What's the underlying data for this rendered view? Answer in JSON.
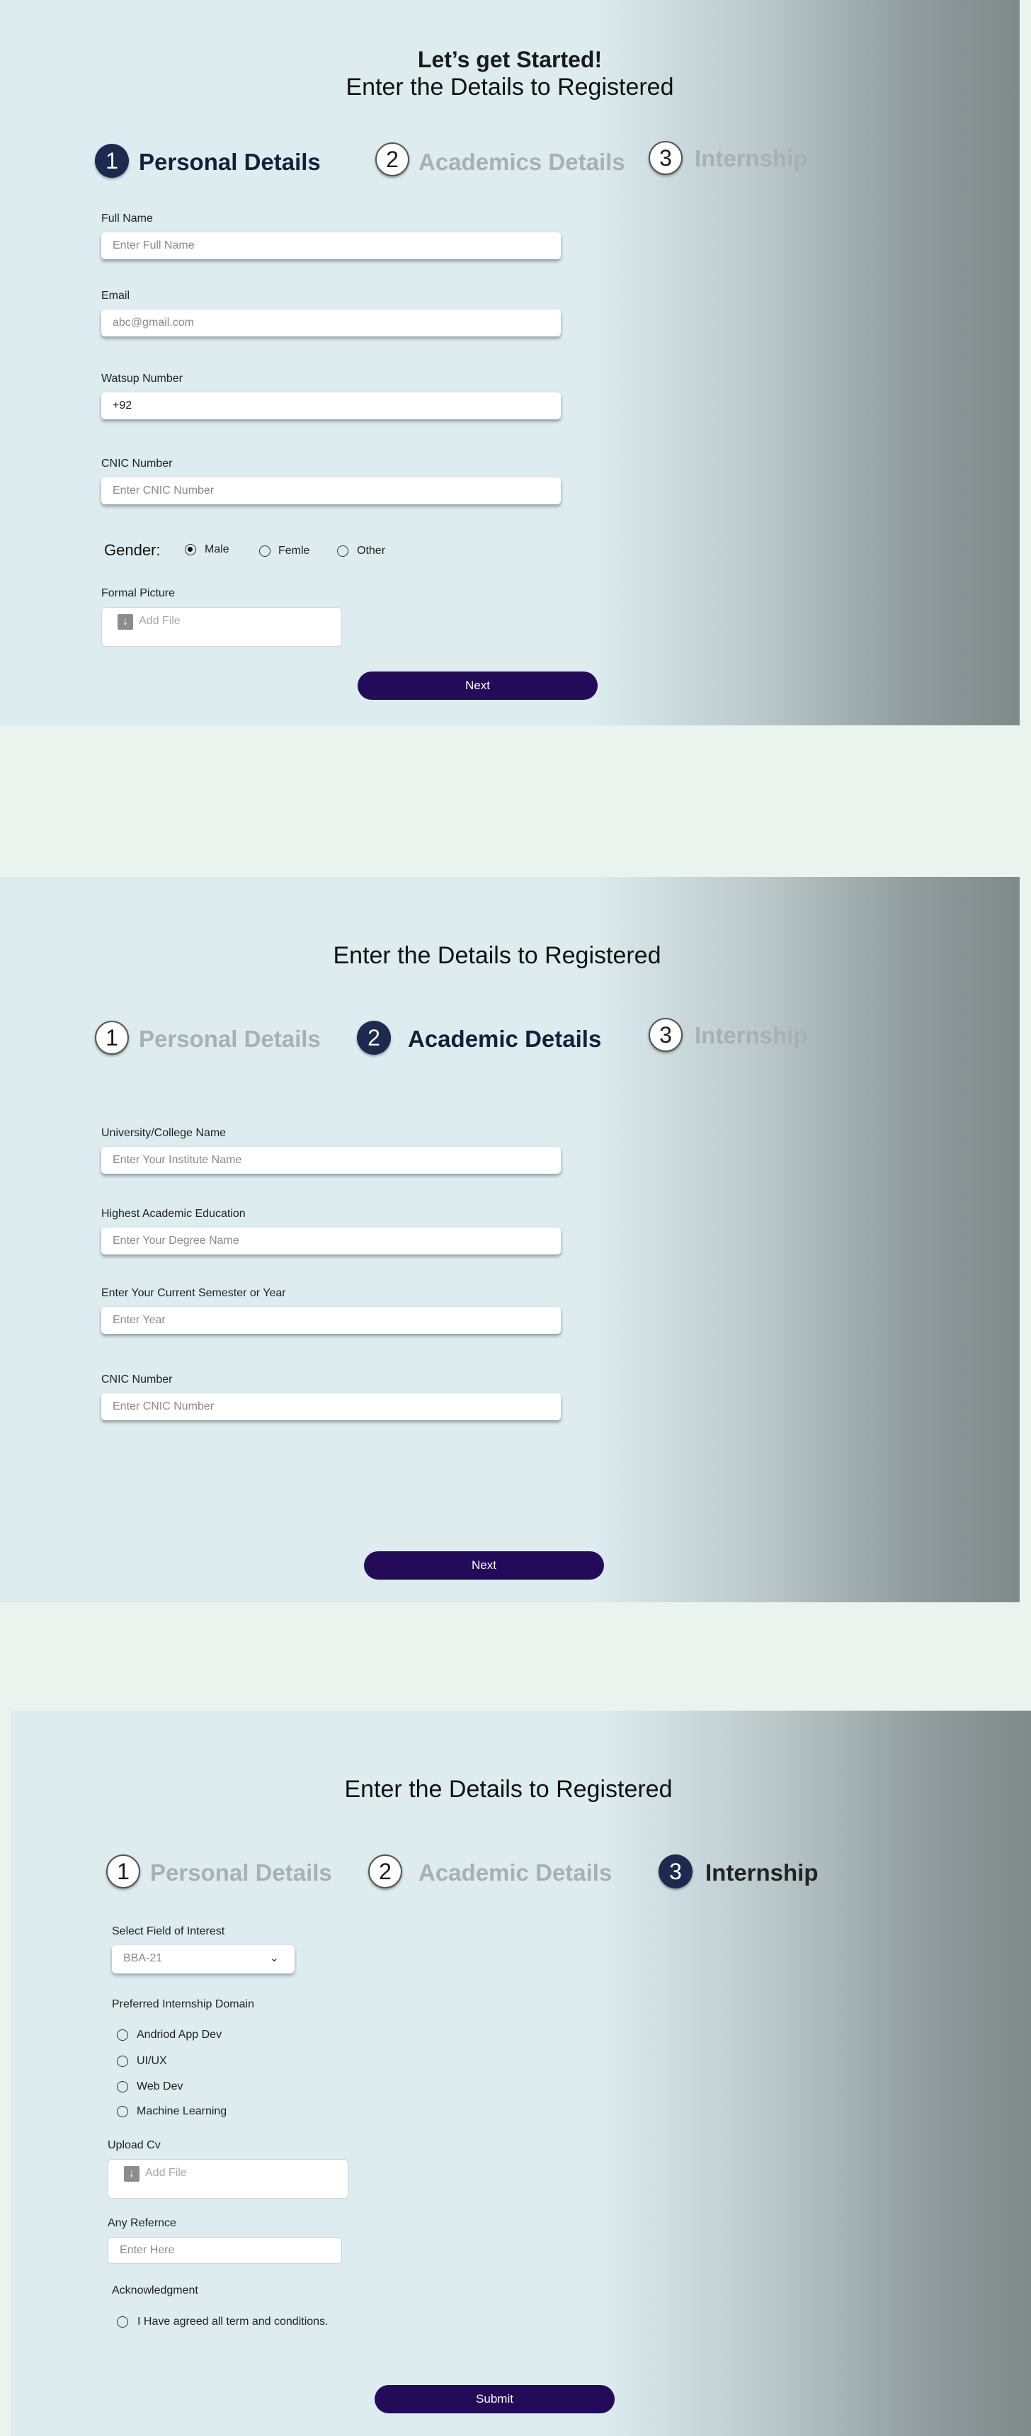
{
  "section1": {
    "heading": "Let’s get Started!",
    "subheading": "Enter the Details to Registered",
    "steps": [
      {
        "num": "1",
        "label": "Personal Details",
        "state": "active"
      },
      {
        "num": "2",
        "label": "Academics Details",
        "state": "inactive"
      },
      {
        "num": "3",
        "label": "Internship",
        "state": "inactive"
      }
    ],
    "fields": {
      "full_name": {
        "label": "Full Name",
        "placeholder": "Enter Full Name"
      },
      "email": {
        "label": "Email",
        "placeholder": "abc@gmail.com"
      },
      "whatsapp": {
        "label": "Watsup Number",
        "value": "+92"
      },
      "cnic": {
        "label": "CNIC Number",
        "placeholder": "Enter CNIC Number"
      }
    },
    "gender": {
      "label": "Gender:",
      "options": [
        "Male",
        "Femle",
        "Other"
      ],
      "selected": "Male"
    },
    "picture": {
      "label": "Formal Picture",
      "placeholder": "Add File"
    },
    "next_label": "Next"
  },
  "section2": {
    "subheading": "Enter the Details to Registered",
    "steps": [
      {
        "num": "1",
        "label": "Personal Details",
        "state": "inactive"
      },
      {
        "num": "2",
        "label": "Academic Details",
        "state": "active"
      },
      {
        "num": "3",
        "label": "Internship",
        "state": "inactive"
      }
    ],
    "fields": {
      "institute": {
        "label": "University/College Name",
        "placeholder": "Enter Your Institute Name"
      },
      "education": {
        "label": "Highest Academic Education",
        "placeholder": "Enter Your Degree Name"
      },
      "semester": {
        "label": "Enter Your Current Semester or Year",
        "placeholder": "Enter Year"
      },
      "cnic": {
        "label": "CNIC Number",
        "placeholder": "Enter CNIC Number"
      }
    },
    "next_label": "Next"
  },
  "section3": {
    "subheading": "Enter the Details to Registered",
    "steps": [
      {
        "num": "1",
        "label": "Personal Details",
        "state": "inactive"
      },
      {
        "num": "2",
        "label": "Academic Details",
        "state": "inactive"
      },
      {
        "num": "3",
        "label": "Internship",
        "state": "active"
      }
    ],
    "interest": {
      "label": "Select Field of Interest",
      "value": "BBA-21"
    },
    "domain": {
      "label": "Preferred Internship Domain",
      "options": [
        "Andriod App Dev",
        "UI/UX",
        "Web Dev",
        "Machine Learning"
      ]
    },
    "cv": {
      "label": "Upload Cv",
      "placeholder": "Add File"
    },
    "reference": {
      "label": "Any Refernce",
      "placeholder": "Enter Here"
    },
    "acknowledgment": {
      "label": "Acknowledgment",
      "text": "I Have agreed all term and conditions."
    },
    "submit_label": "Submit"
  },
  "colors": {
    "primary_button": "#240b5a",
    "active_step": "#1b2a4e",
    "inactive_step_text": "#a9b0b3",
    "page_background": "#eaf3ee",
    "panel_background": "#dcecef"
  }
}
